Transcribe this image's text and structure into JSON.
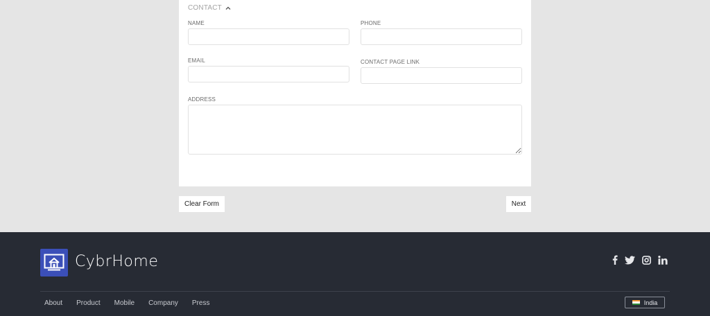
{
  "form": {
    "section_title": "CONTACT",
    "section_chevron_icon": "chevron-up-icon",
    "fields": {
      "name": {
        "label": "NAME",
        "value": "",
        "placeholder": ""
      },
      "phone": {
        "label": "PHONE",
        "value": "",
        "placeholder": ""
      },
      "email": {
        "label": "EMAIL",
        "value": "",
        "placeholder": ""
      },
      "contact_page_link": {
        "label": "CONTACT PAGE LINK",
        "value": "",
        "placeholder": ""
      },
      "address": {
        "label": "ADDRESS",
        "value": "",
        "placeholder": ""
      }
    }
  },
  "actions": {
    "clear_label": "Clear Form",
    "next_label": "Next"
  },
  "footer": {
    "brand_name": "CybrHome",
    "logo_icon": "home-monitor-icon",
    "brand_color": "#3b4fb8",
    "social_icons": [
      "facebook-icon",
      "twitter-icon",
      "instagram-icon",
      "linkedin-icon"
    ],
    "nav": [
      "About",
      "Product",
      "Mobile",
      "Company",
      "Press"
    ],
    "region": {
      "label": "India",
      "flag_icon": "india-flag-icon"
    }
  },
  "colors": {
    "page_background": "#e5e5e5",
    "card_background": "#ffffff",
    "footer_background": "#272b34"
  }
}
